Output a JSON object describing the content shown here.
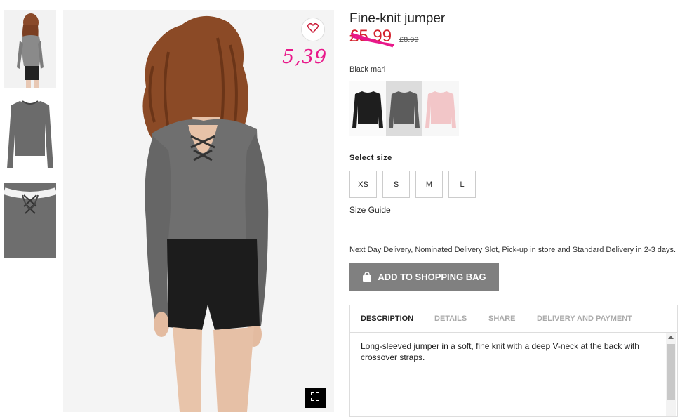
{
  "product": {
    "title": "Fine-knit jumper",
    "price_current": "£5.99",
    "price_original": "£8.99",
    "handwritten_price": "5,39"
  },
  "colors": {
    "selected_label": "Black marl",
    "options": [
      "black",
      "black-marl",
      "light-pink"
    ],
    "accent_red": "#d4232e",
    "annotation_pink": "#e8188a",
    "button_gray": "#808080"
  },
  "sizes": {
    "label": "Select size",
    "options": [
      "XS",
      "S",
      "M",
      "L"
    ],
    "guide_label": "Size Guide"
  },
  "delivery": {
    "note": "Next Day Delivery, Nominated Delivery Slot, Pick-up in store and Standard Delivery in 2-3 days."
  },
  "cart": {
    "add_label": "ADD TO SHOPPING BAG"
  },
  "info_tabs": {
    "tabs": [
      "DESCRIPTION",
      "DETAILS",
      "SHARE",
      "DELIVERY AND PAYMENT"
    ],
    "active": "DESCRIPTION",
    "description": "Long-sleeved jumper in a soft, fine knit with a deep V-neck at the back with crossover straps."
  },
  "icons": {
    "favorite": "heart-icon",
    "fullscreen": "expand-icon",
    "bag": "shopping-bag-icon"
  }
}
